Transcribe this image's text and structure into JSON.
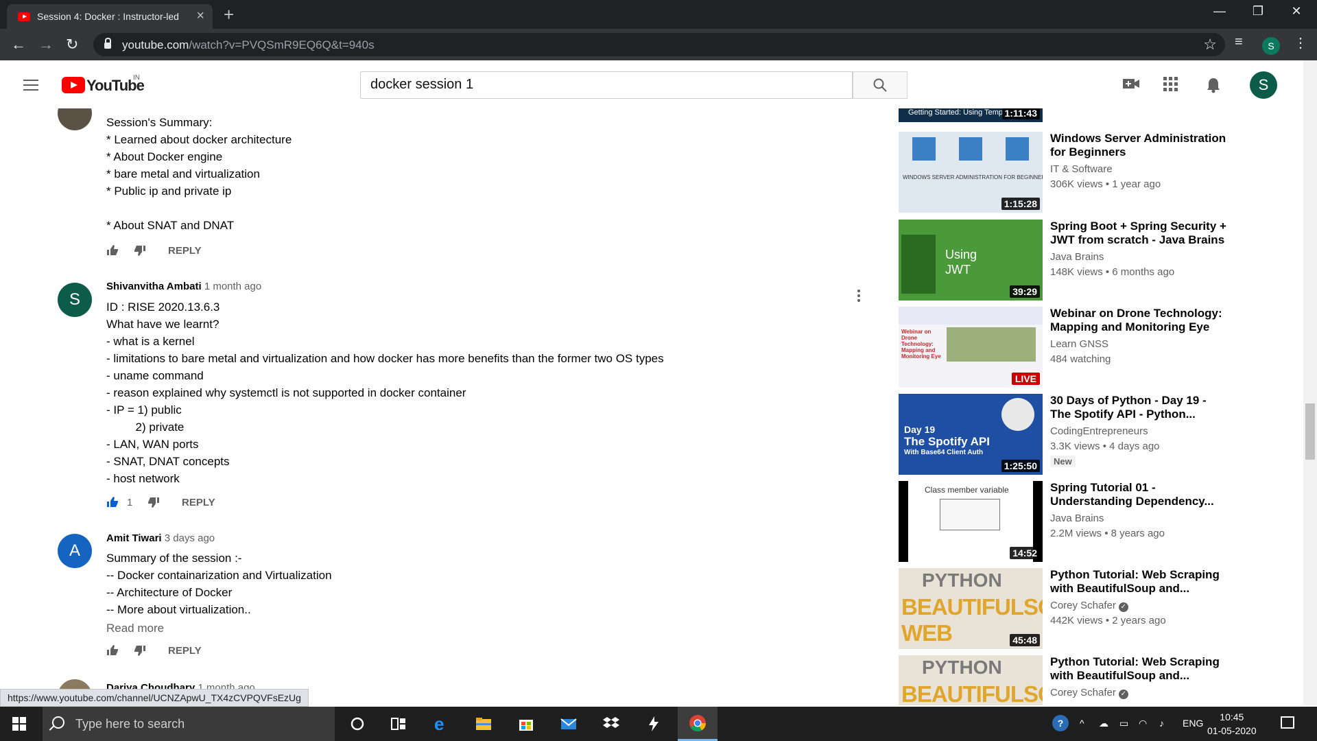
{
  "browser": {
    "tab_title": "Session 4: Docker : Instructor-led",
    "url_host": "youtube.com",
    "url_path": "/watch?v=PVQSmR9EQ6Q&t=940s",
    "profile_initial": "S"
  },
  "youtube": {
    "logo_text": "YouTube",
    "country_code": "IN",
    "search_value": "docker session 1",
    "avatar_initial": "S"
  },
  "comments": [
    {
      "avatar": "",
      "author": "",
      "time": "",
      "text": "Session's Summary:\n* Learned about docker architecture\n* About Docker engine\n* bare metal and virtualization\n* Public ip and private ip\n\n* About SNAT and DNAT",
      "likes": "",
      "reply_label": "REPLY"
    },
    {
      "avatar": "S",
      "author": "Shivanvitha Ambati",
      "time": "1 month ago",
      "text": "ID : RISE 2020.13.6.3\nWhat have we learnt?\n- what is a kernel\n- limitations to bare metal and virtualization and how docker has more benefits than the former two OS types\n- uname command\n- reason explained why systemctl is not supported in docker container\n- IP = 1) public\n         2) private\n- LAN, WAN ports\n- SNAT, DNAT concepts\n- host network",
      "likes": "1",
      "reply_label": "REPLY"
    },
    {
      "avatar": "A",
      "author": "Amit Tiwari",
      "time": "3 days ago",
      "text": "Summary of the session :-\n-- Docker containarization and Virtualization\n-- Architecture of Docker\n-- More about virtualization..",
      "read_more": "Read more",
      "likes": "",
      "reply_label": "REPLY"
    },
    {
      "author": "Dariya Choudhary",
      "time": "1 month ago"
    }
  ],
  "sidebar": [
    {
      "thumb_caption": "Getting Started: Using Temp",
      "duration": "1:11:43"
    },
    {
      "title": "Windows Server Administration for Beginners",
      "channel": "IT & Software",
      "meta": "306K views • 1 year ago",
      "duration": "1:15:28",
      "thumb_caption": "WINDOWS SERVER ADMINISTRATION FOR BEGINNERS"
    },
    {
      "title": "Spring Boot + Spring Security + JWT from scratch - Java Brains",
      "channel": "Java Brains",
      "meta": "148K views • 6 months ago",
      "duration": "39:29",
      "thumb_caption": "Using JWT"
    },
    {
      "title": "Webinar on Drone Technology: Mapping and Monitoring Eye",
      "channel": "Learn GNSS",
      "meta": "484 watching",
      "badge": "LIVE",
      "thumb_caption": "Webinar on Drone Technology: Mapping and Monitoring Eye"
    },
    {
      "title": "30 Days of Python - Day 19 - The Spotify API - Python...",
      "channel": "CodingEntrepreneurs",
      "meta": "3.3K views • 4 days ago",
      "new_label": "New",
      "duration": "1:25:50",
      "thumb_caption": "Day 19",
      "thumb_caption2": "The Spotify API",
      "thumb_caption3": "With Base64 Client Auth"
    },
    {
      "title": "Spring Tutorial 01 - Understanding Dependency...",
      "channel": "Java Brains",
      "meta": "2.2M views • 8 years ago",
      "duration": "14:52",
      "thumb_caption": "Class member variable"
    },
    {
      "title": "Python Tutorial: Web Scraping with BeautifulSoup and...",
      "channel": "Corey Schafer",
      "meta": "442K views • 2 years ago",
      "duration": "45:48",
      "thumb_caption": "PYTHON",
      "thumb_caption2": "BEAUTIFULSOUP",
      "thumb_caption3": "WEB SCRAPING"
    },
    {
      "title": "Python Tutorial: Web Scraping with BeautifulSoup and...",
      "channel": "Corey Schafer",
      "thumb_caption": "PYTHON",
      "thumb_caption2": "BEAUTIFULSOUP"
    }
  ],
  "status_url": "https://www.youtube.com/channel/UCNZApwU_TX4zCVPQVFsEzUg",
  "taskbar": {
    "search_placeholder": "Type here to search",
    "language": "ENG",
    "time": "10:45",
    "date": "01-05-2020"
  },
  "colors": {
    "youtube_red": "#ff0000",
    "avatar_green": "#0d5c4a",
    "avatar_blue": "#1565c0",
    "like_active": "#065fd4"
  }
}
